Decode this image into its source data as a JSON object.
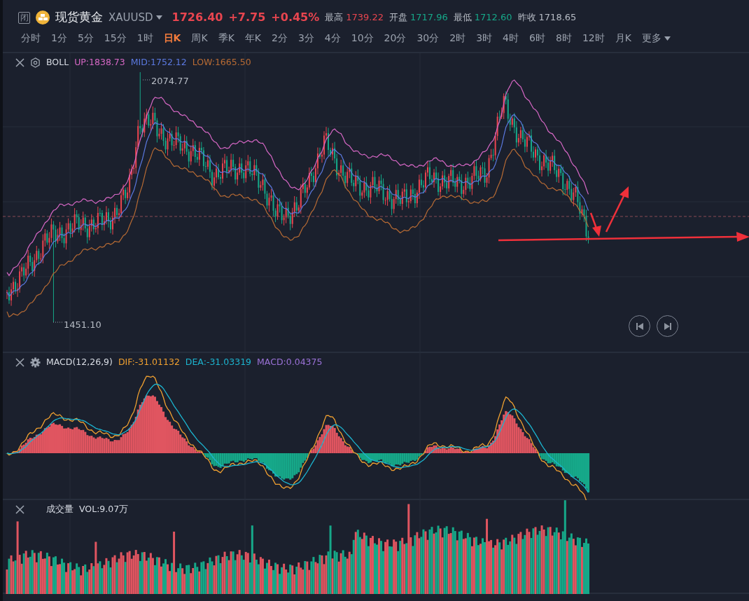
{
  "header": {
    "close_badge": "闭",
    "name": "现货黄金",
    "symbol": "XAUUSD",
    "quote": [
      {
        "text": "1726.40",
        "color": "#e8454f"
      },
      {
        "text": "+7.75",
        "color": "#e8454f"
      },
      {
        "text": "+0.45%",
        "color": "#e8454f"
      }
    ],
    "stats": [
      {
        "label": "最高",
        "value": "1739.22",
        "color": "#e8454f"
      },
      {
        "label": "开盘",
        "value": "1717.96",
        "color": "#16a889"
      },
      {
        "label": "最低",
        "value": "1712.60",
        "color": "#16a889"
      },
      {
        "label": "昨收",
        "value": "1718.65",
        "color": "#b7bcc5"
      }
    ]
  },
  "timeframes": [
    {
      "label": "分时",
      "selected": false
    },
    {
      "label": "1分",
      "selected": false
    },
    {
      "label": "5分",
      "selected": false
    },
    {
      "label": "15分",
      "selected": false
    },
    {
      "label": "1时",
      "selected": false
    },
    {
      "label": "日K",
      "selected": true
    },
    {
      "label": "周K",
      "selected": false
    },
    {
      "label": "季K",
      "selected": false
    },
    {
      "label": "年K",
      "selected": false
    },
    {
      "label": "2分",
      "selected": false
    },
    {
      "label": "3分",
      "selected": false
    },
    {
      "label": "4分",
      "selected": false
    },
    {
      "label": "10分",
      "selected": false
    },
    {
      "label": "20分",
      "selected": false
    },
    {
      "label": "30分",
      "selected": false
    },
    {
      "label": "2时",
      "selected": false
    },
    {
      "label": "3时",
      "selected": false
    },
    {
      "label": "4时",
      "selected": false
    },
    {
      "label": "6时",
      "selected": false
    },
    {
      "label": "8时",
      "selected": false
    },
    {
      "label": "12时",
      "selected": false
    },
    {
      "label": "月K",
      "selected": false
    }
  ],
  "more": "更多",
  "panels": [
    {
      "kind": "boll",
      "name": "BOLL",
      "values": [
        {
          "text": "UP:1838.73",
          "color": "#d667c5"
        },
        {
          "text": "MID:1752.12",
          "color": "#5b79e0"
        },
        {
          "text": "LOW:1665.50",
          "color": "#b86b34"
        }
      ],
      "high_label": "2074.77",
      "low_label": "1451.10"
    },
    {
      "kind": "macd",
      "name": "MACD(12,26,9)",
      "values": [
        {
          "text": "DIF:-31.01132",
          "color": "#f0a030"
        },
        {
          "text": "DEA:-31.03319",
          "color": "#1cb5d0"
        },
        {
          "text": "MACD:0.04375",
          "color": "#9b72d8"
        }
      ]
    },
    {
      "kind": "vol",
      "name": "成交量",
      "values": [
        {
          "text": "VOL:9.07万",
          "color": "#d8dce4"
        }
      ]
    }
  ]
}
